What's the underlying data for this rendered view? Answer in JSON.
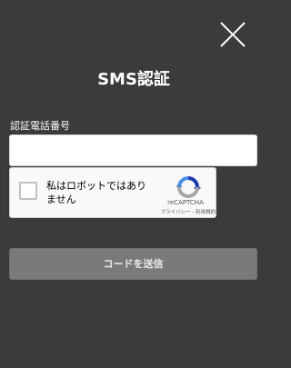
{
  "dialog": {
    "title": "SMS認証",
    "close_icon": "close-icon"
  },
  "phone": {
    "label": "認証電話番号",
    "value": "",
    "placeholder": ""
  },
  "recaptcha": {
    "checkbox_label": "私はロボットではありません",
    "checked": false,
    "logo_icon": "recaptcha-logo-icon",
    "brand": "reCAPTCHA",
    "privacy_link": "プライバシー",
    "separator": " - ",
    "terms_link": "利用規約"
  },
  "submit": {
    "label": "コードを送信"
  },
  "colors": {
    "background": "#3b3b3b",
    "button": "#7a7a7a",
    "recaptcha_blue": "#4a90e2",
    "recaptcha_gray": "#a6a6a6"
  }
}
